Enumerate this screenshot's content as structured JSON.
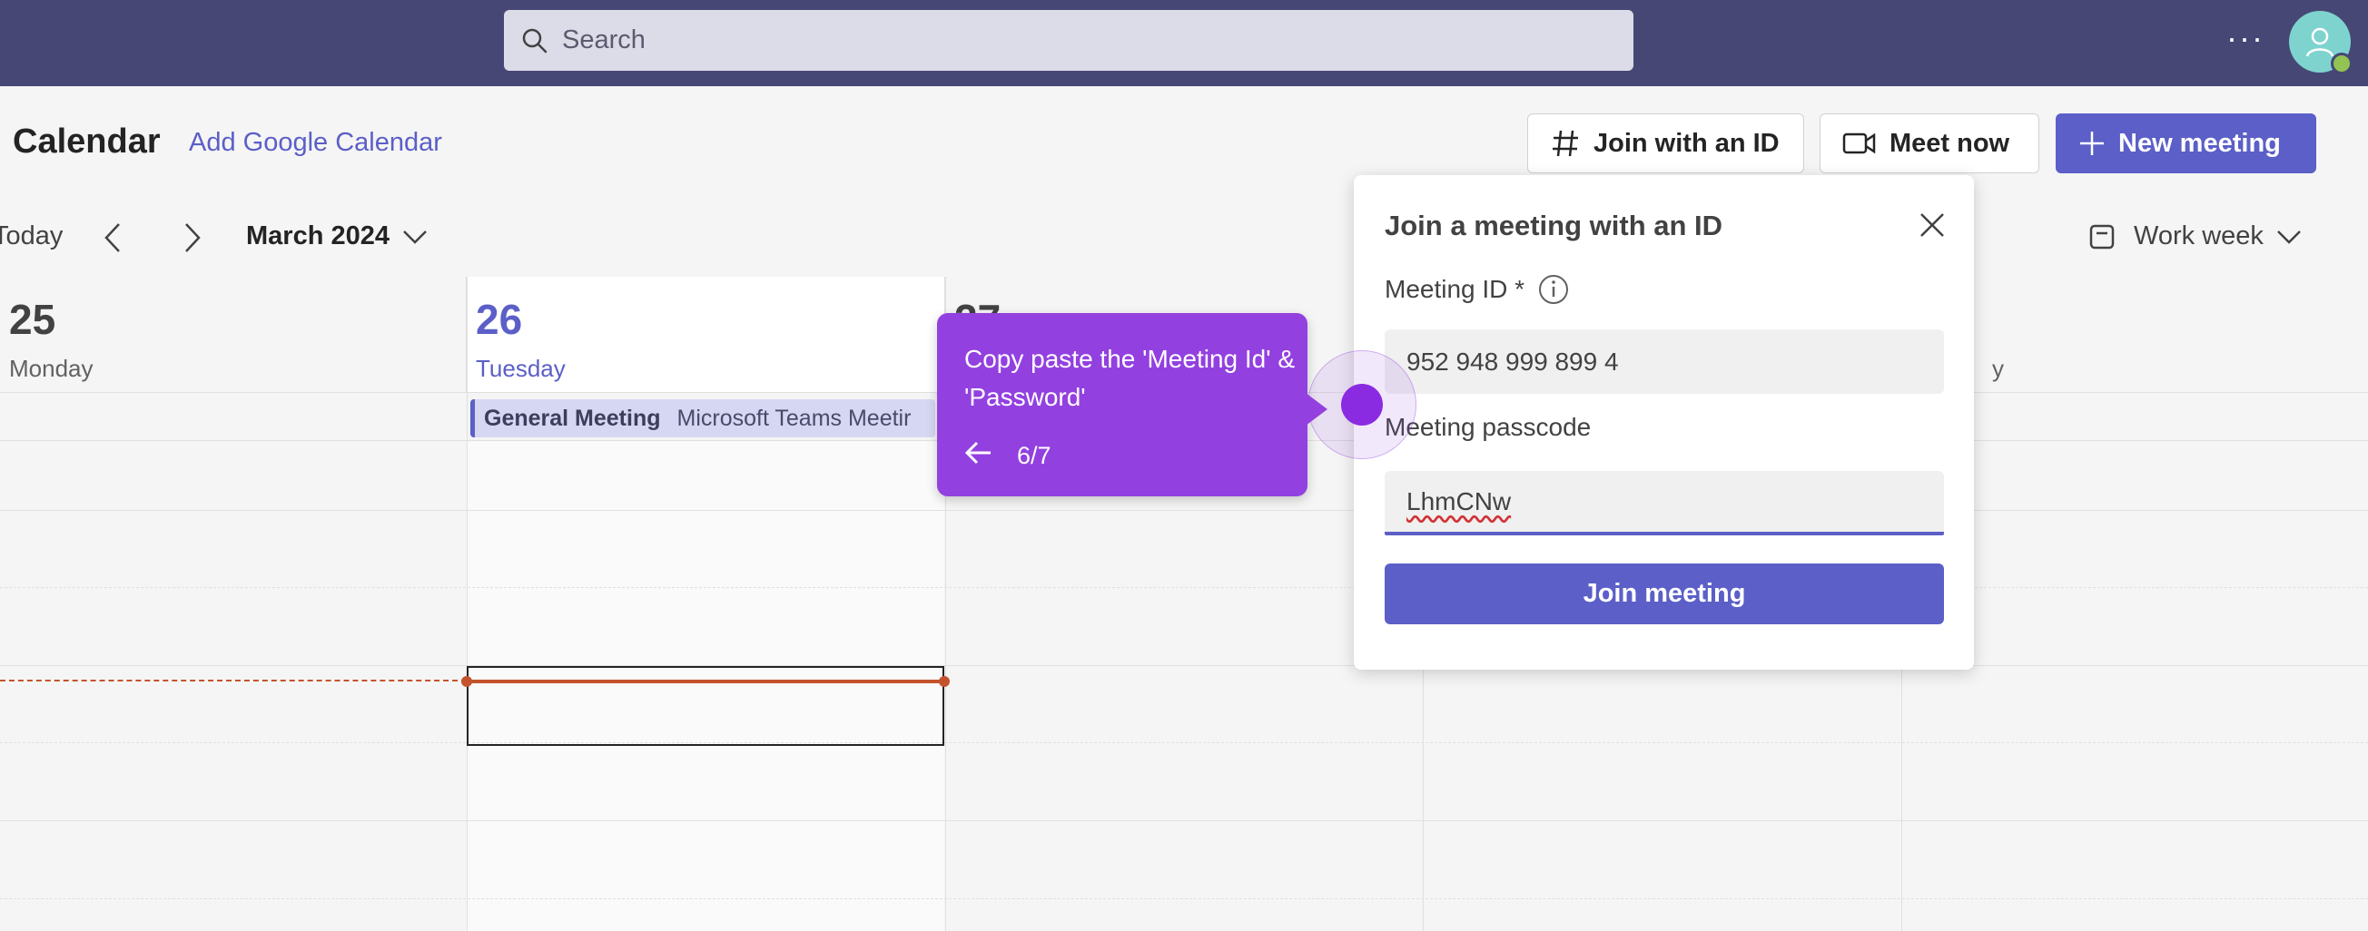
{
  "topbar": {
    "search_placeholder": "Search",
    "more_label": "···"
  },
  "header": {
    "title": "Calendar",
    "add_google": "Add Google Calendar",
    "join_with_id": "Join with an ID",
    "meet_now": "Meet now",
    "new_meeting": "New meeting"
  },
  "nav": {
    "today": "Today",
    "month": "March 2024",
    "view": "Work week"
  },
  "days": [
    {
      "num": "25",
      "name": "Monday"
    },
    {
      "num": "26",
      "name": "Tuesday"
    },
    {
      "num": "27",
      "name": ""
    },
    {
      "num": "",
      "name": ""
    },
    {
      "num": "",
      "name": "y"
    }
  ],
  "event": {
    "title": "General Meeting",
    "subtitle": "Microsoft Teams Meetir"
  },
  "popup": {
    "title": "Join a meeting with an ID",
    "id_label": "Meeting ID *",
    "id_value": "952 948 999 899 4",
    "passcode_label": "Meeting passcode",
    "passcode_value": "LhmCNw",
    "join_button": "Join meeting"
  },
  "guide": {
    "text": "Copy paste the 'Meeting Id' & 'Password'",
    "step": "6/7"
  },
  "colors": {
    "topbar": "#464775",
    "accent": "#5b5fc7",
    "guide": "#9340e0",
    "now_line": "#c4532d"
  }
}
